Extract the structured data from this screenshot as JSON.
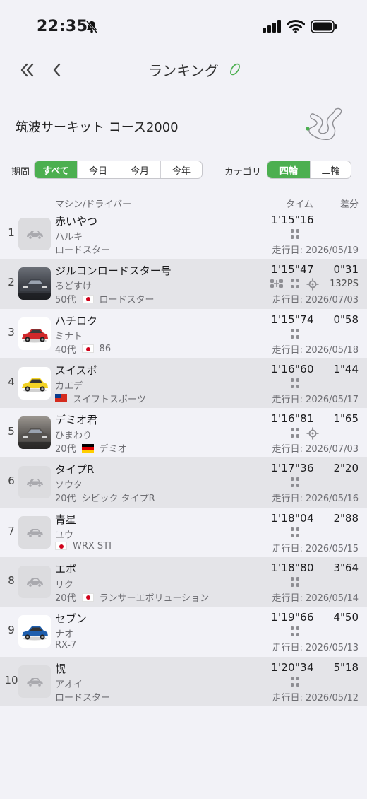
{
  "status_bar": {
    "time": "22:35"
  },
  "nav": {
    "title": "ランキング"
  },
  "course": {
    "name": "筑波サーキット コース2000"
  },
  "filters": {
    "period_label": "期間",
    "period_options": [
      "すべて",
      "今日",
      "今月",
      "今年"
    ],
    "period_selected": "すべて",
    "category_label": "カテゴリ",
    "category_options": [
      "四輪",
      "二輪"
    ],
    "category_selected": "四輪"
  },
  "table_header": {
    "machine_driver": "マシン/ドライバー",
    "time": "タイム",
    "diff": "差分"
  },
  "accent_color": "#4caf50",
  "rows": [
    {
      "rank": "1",
      "name": "赤いやつ",
      "driver": "ハルキ",
      "meta": "ロードスター",
      "age": "",
      "flag": "",
      "time": "1'15\"16",
      "diff": "",
      "power": "",
      "date": "走行日: 2026/05/19",
      "thumb": "placeholder",
      "icons": [
        "drivetrain-icon"
      ]
    },
    {
      "rank": "2",
      "name": "ジルコンロードスター号",
      "driver": "ろどすけ",
      "meta": "ロードスター",
      "age": "50代",
      "flag": "jp",
      "time": "1'15\"47",
      "diff": "0\"31",
      "power": "132PS",
      "date": "走行日: 2026/07/03",
      "thumb": "photo-dark",
      "icons": [
        "suspension-icon",
        "drivetrain-icon",
        "turbo-icon"
      ]
    },
    {
      "rank": "3",
      "name": "ハチロク",
      "driver": "ミナト",
      "meta": "86",
      "age": "40代",
      "flag": "jp",
      "time": "1'15\"74",
      "diff": "0\"58",
      "power": "",
      "date": "走行日: 2026/05/18",
      "thumb": "red-car",
      "icons": [
        "drivetrain-icon"
      ]
    },
    {
      "rank": "4",
      "name": "スイスポ",
      "driver": "カエデ",
      "meta": "スイフトスポーツ",
      "age": "",
      "flag": "tw",
      "time": "1'16\"60",
      "diff": "1\"44",
      "power": "",
      "date": "走行日: 2026/05/17",
      "thumb": "yellow-car",
      "icons": [
        "drivetrain-icon"
      ]
    },
    {
      "rank": "5",
      "name": "デミオ君",
      "driver": "ひまわり",
      "meta": "デミオ",
      "age": "20代",
      "flag": "de",
      "time": "1'16\"81",
      "diff": "1\"65",
      "power": "",
      "date": "走行日: 2026/07/03",
      "thumb": "photo-grey",
      "icons": [
        "drivetrain-icon",
        "turbo-icon"
      ]
    },
    {
      "rank": "6",
      "name": "タイプR",
      "driver": "ソウタ",
      "meta": "シビック タイプR",
      "age": "20代",
      "flag": "",
      "time": "1'17\"36",
      "diff": "2\"20",
      "power": "",
      "date": "走行日: 2026/05/16",
      "thumb": "placeholder",
      "icons": [
        "drivetrain-icon"
      ]
    },
    {
      "rank": "7",
      "name": "青星",
      "driver": "ユウ",
      "meta": "WRX STI",
      "age": "",
      "flag": "jp",
      "time": "1'18\"04",
      "diff": "2\"88",
      "power": "",
      "date": "走行日: 2026/05/15",
      "thumb": "placeholder",
      "icons": [
        "drivetrain-icon"
      ]
    },
    {
      "rank": "8",
      "name": "エボ",
      "driver": "リク",
      "meta": "ランサーエボリューション",
      "age": "20代",
      "flag": "jp",
      "time": "1'18\"80",
      "diff": "3\"64",
      "power": "",
      "date": "走行日: 2026/05/14",
      "thumb": "placeholder",
      "icons": [
        "drivetrain-icon"
      ]
    },
    {
      "rank": "9",
      "name": "セブン",
      "driver": "ナオ",
      "meta": "RX-7",
      "age": "",
      "flag": "",
      "time": "1'19\"66",
      "diff": "4\"50",
      "power": "",
      "date": "走行日: 2026/05/13",
      "thumb": "blue-car",
      "icons": [
        "drivetrain-icon"
      ]
    },
    {
      "rank": "10",
      "name": "幌",
      "driver": "アオイ",
      "meta": "ロードスター",
      "age": "",
      "flag": "",
      "time": "1'20\"34",
      "diff": "5\"18",
      "power": "",
      "date": "走行日: 2026/05/12",
      "thumb": "placeholder",
      "icons": [
        "drivetrain-icon"
      ]
    }
  ]
}
